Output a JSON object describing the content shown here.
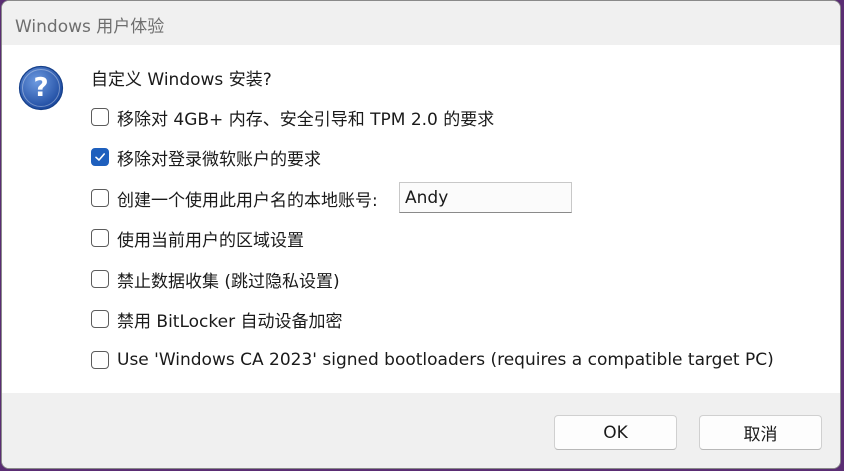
{
  "window": {
    "title": "Windows 用户体验"
  },
  "dialog": {
    "heading": "自定义 Windows 安装?",
    "icon": "question-icon",
    "options": [
      {
        "label": "移除对 4GB+ 内存、安全引导和 TPM 2.0 的要求",
        "checked": false
      },
      {
        "label": "移除对登录微软账户的要求",
        "checked": true
      },
      {
        "label": "创建一个使用此用户名的本地账号:",
        "checked": false
      },
      {
        "label": "使用当前用户的区域设置",
        "checked": false
      },
      {
        "label": "禁止数据收集 (跳过隐私设置)",
        "checked": false
      },
      {
        "label": "禁用 BitLocker 自动设备加密",
        "checked": false
      },
      {
        "label": "Use 'Windows CA 2023' signed bootloaders (requires a compatible target PC)",
        "checked": false
      }
    ],
    "username_value": "Andy"
  },
  "buttons": {
    "ok": "OK",
    "cancel": "取消"
  },
  "colors": {
    "accent": "#1e5fbd",
    "titlebar": "#f0f0f0",
    "footer": "#f0f0f0",
    "icon_blue": "#2f5fb3"
  }
}
